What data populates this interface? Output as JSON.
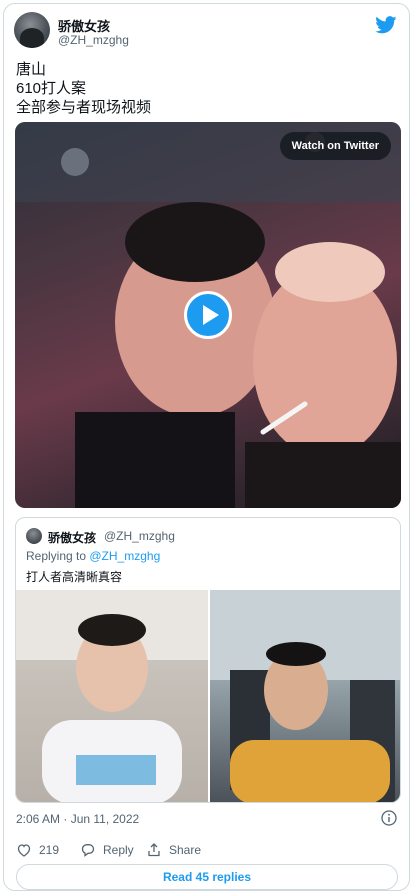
{
  "author": {
    "name": "骄傲女孩",
    "handle": "@ZH_mzghg"
  },
  "tweet": {
    "lines": [
      "唐山",
      "610打人案",
      "全部参与者现场视频"
    ]
  },
  "video": {
    "watch_label": "Watch on Twitter"
  },
  "quoted": {
    "name": "骄傲女孩",
    "handle": "@ZH_mzghg",
    "replying_prefix": "Replying to ",
    "replying_to": "@ZH_mzghg",
    "text": "打人者高清晰真容"
  },
  "meta": {
    "timestamp": "2:06 AM · Jun 11, 2022"
  },
  "actions": {
    "like_count": "219",
    "reply_label": "Reply",
    "share_label": "Share"
  },
  "replies_button": "Read 45 replies",
  "colors": {
    "accent": "#1d9bf0",
    "like": "#f91880",
    "muted": "#536471",
    "border": "#cfd9de"
  },
  "icons": [
    "twitter-bird-icon",
    "play-icon",
    "info-icon",
    "heart-icon",
    "reply-icon",
    "share-icon"
  ]
}
